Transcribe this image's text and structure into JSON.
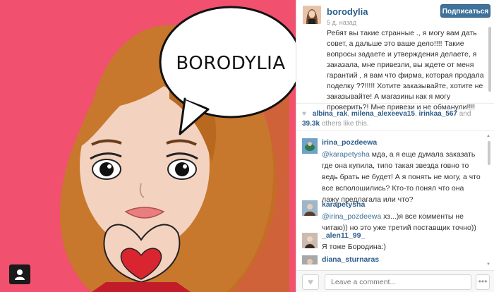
{
  "photo": {
    "bubble_text": "BORODYLIA",
    "background_color": "#f1506e"
  },
  "post": {
    "username": "borodylia",
    "time_ago": "5 д. назад",
    "follow_label": "Подписаться",
    "caption": "Ребят вы такие странные ., я могу вам дать совет, а дальше это ваше дело!!!! Такие вопросы задаете и утверждения делаете, я заказала, мне привезли, вы ждете от меня гарантий , я вам что фирма, которая продала поделку ??!!!!! Хотите заказывайте, хотите не заказывайте! А магазины как я могу проверить?! Мне привези и не обманули!!!!"
  },
  "likes": {
    "users": [
      "albina_rak",
      "milena_alexeeva15",
      "irinkaa_567"
    ],
    "sep1": ", ",
    "sep2": ", ",
    "and": "and",
    "count": "39.3k",
    "suffix": "others like this."
  },
  "comments": [
    {
      "username": "irina_pozdeewa",
      "mention": "@karapetysha",
      "text": " мда, а я еще думала заказать где она купила, типо такая звезда говно то ведь брать не будет! А я понять не могу, а что все всполошились? Кто-то понял что она лажу предлагала или что?"
    },
    {
      "username": "karapetysha",
      "mention": "@irina_pozdeewa",
      "text": " хз...)я все комменты не читаю)) но это уже третий поставщик точно))"
    },
    {
      "username": "_alen11_99_",
      "mention": "",
      "text": "Я тоже Бородина:)"
    },
    {
      "username": "diana_sturnaras",
      "mention": "",
      "text": ""
    }
  ],
  "footer": {
    "comment_placeholder": "Leave a comment...",
    "more_label": "•••"
  },
  "icons": {
    "like": "heart-icon",
    "profile": "user-icon",
    "more": "ellipsis-icon"
  }
}
